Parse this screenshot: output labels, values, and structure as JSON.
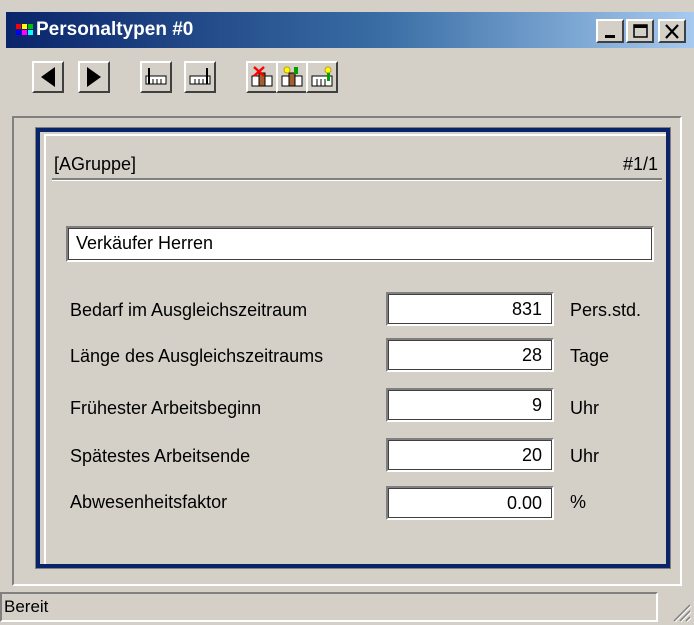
{
  "window": {
    "title": "Personaltypen #0",
    "controls": [
      "minimize-icon",
      "maximize-icon",
      "close-icon"
    ]
  },
  "toolbar": {
    "buttons": [
      {
        "name": "previous-record-button",
        "icon": "arrow-left-icon"
      },
      {
        "name": "next-record-button",
        "icon": "arrow-right-icon"
      },
      {
        "name": "first-record-button",
        "icon": "record-first-icon"
      },
      {
        "name": "last-record-button",
        "icon": "record-last-icon"
      },
      {
        "name": "delete-record-button",
        "icon": "delete-record-icon"
      },
      {
        "name": "copy-record-button",
        "icon": "copy-record-icon"
      },
      {
        "name": "new-record-button",
        "icon": "new-record-icon"
      }
    ]
  },
  "panel": {
    "group_label": "[AGruppe]",
    "record_counter": "#1/1",
    "name_value": "Verkäufer Herren",
    "rows": [
      {
        "label": "Bedarf im Ausgleichszeitraum",
        "value": "831",
        "unit": "Pers.std."
      },
      {
        "label": "Länge des Ausgleichszeitraums",
        "value": "28",
        "unit": "Tage"
      },
      {
        "label": "Frühester Arbeitsbeginn",
        "value": "9",
        "unit": "Uhr"
      },
      {
        "label": "Spätestes Arbeitsende",
        "value": "20",
        "unit": "Uhr"
      },
      {
        "label": "Abwesenheitsfaktor",
        "value": "0.00",
        "unit": "%"
      }
    ]
  },
  "statusbar": {
    "text": "Bereit"
  }
}
